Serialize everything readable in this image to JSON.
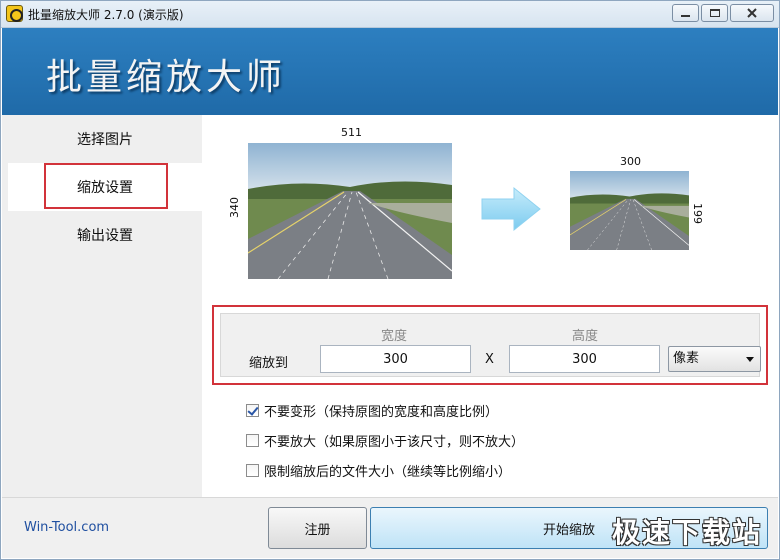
{
  "window": {
    "title": "批量缩放大师 2.7.0 (演示版)",
    "icons": [
      "app-icon",
      "minimize-icon",
      "maximize-icon",
      "close-icon"
    ]
  },
  "banner": {
    "title": "批量缩放大师"
  },
  "sidebar": {
    "items": [
      {
        "label": "选择图片",
        "active": false
      },
      {
        "label": "缩放设置",
        "active": true
      },
      {
        "label": "输出设置",
        "active": false
      }
    ]
  },
  "preview": {
    "original": {
      "width": "511",
      "height": "340"
    },
    "result": {
      "width": "300",
      "height": "199"
    },
    "arrow_icon": "arrow-right-icon"
  },
  "resize": {
    "label": "缩放到",
    "width_header": "宽度",
    "height_header": "高度",
    "width_value": "300",
    "height_value": "300",
    "separator": "X",
    "unit": "像素"
  },
  "options": [
    {
      "label": "不要变形（保持原图的宽度和高度比例）",
      "checked": true
    },
    {
      "label": "不要放大（如果原图小于该尺寸，则不放大）",
      "checked": false
    },
    {
      "label": "限制缩放后的文件大小（继续等比例缩小）",
      "checked": false
    }
  ],
  "footer": {
    "link": "Win-Tool.com",
    "register_label": "注册",
    "start_label": "开始缩放",
    "watermark": "极速下载站"
  },
  "colors": {
    "banner": "#1f6aa8",
    "highlight": "#d2333a",
    "link": "#1f4fa0"
  }
}
